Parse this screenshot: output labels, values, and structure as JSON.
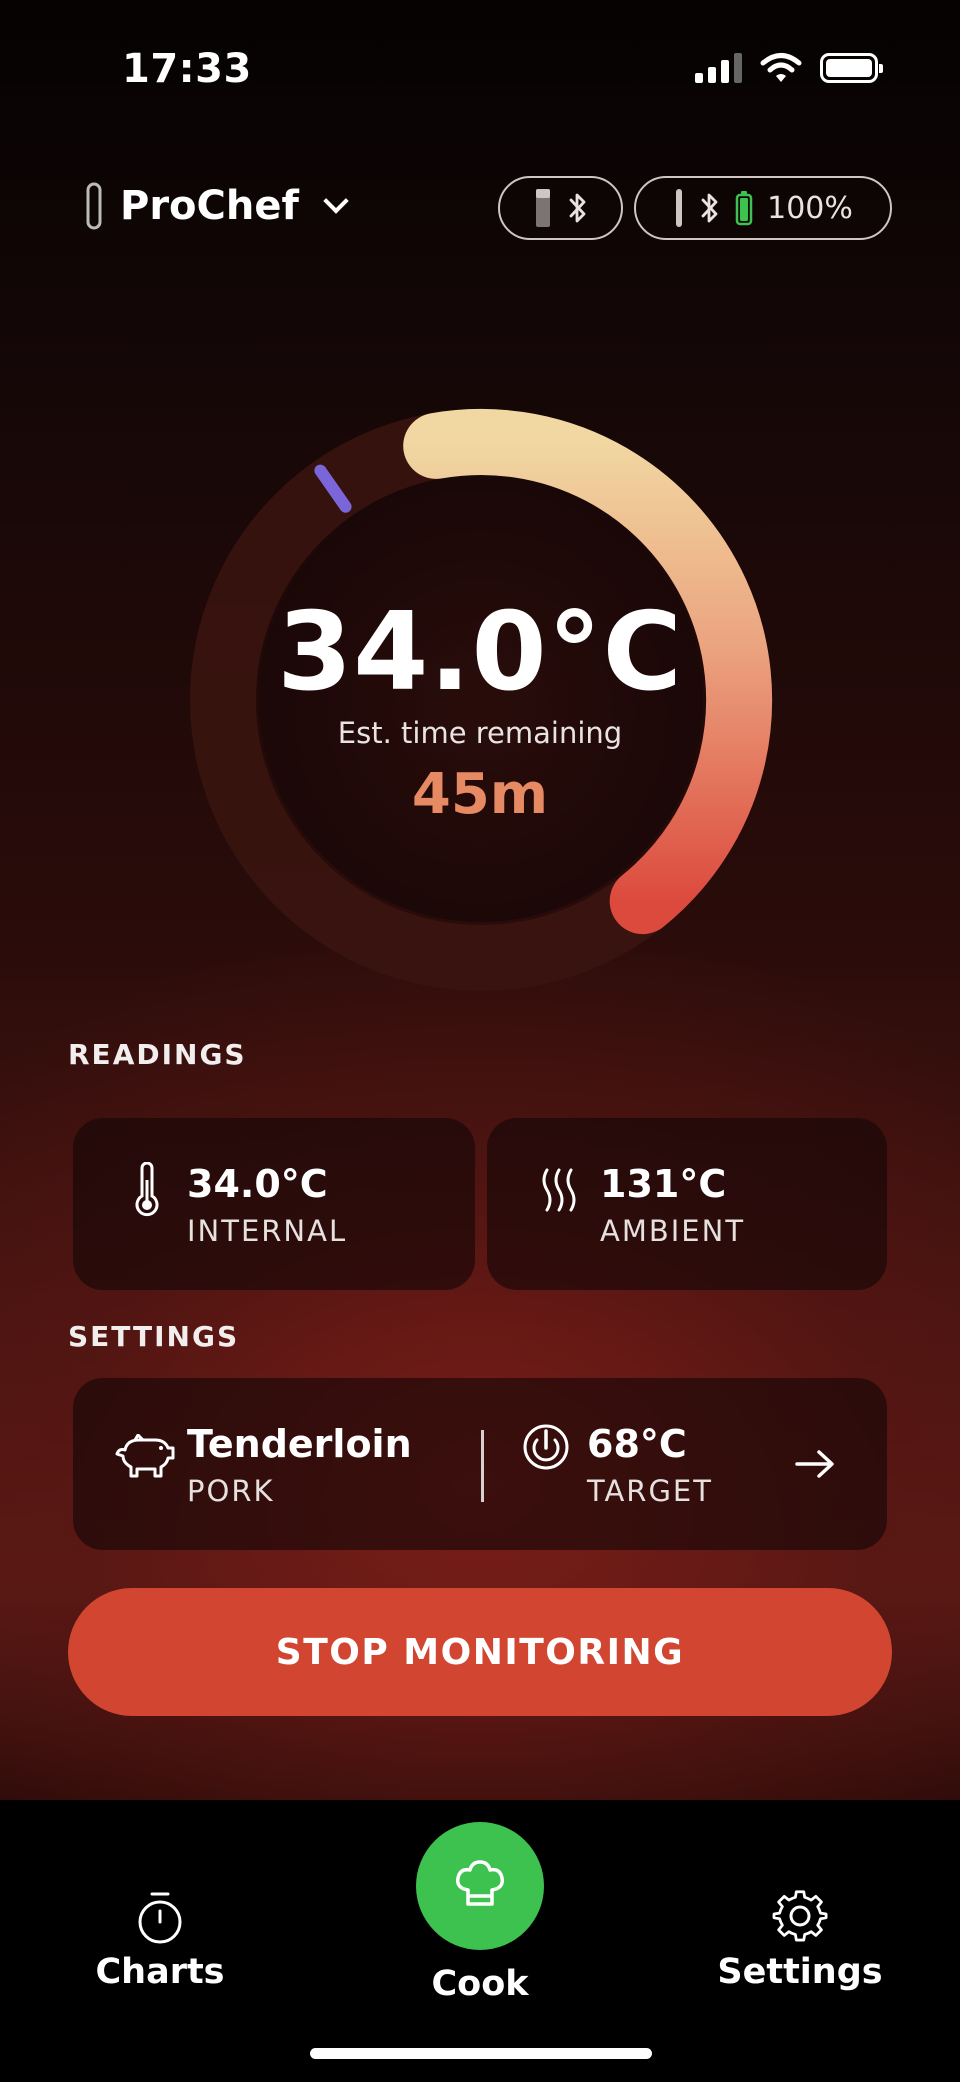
{
  "status_bar": {
    "time": "17:33",
    "icons": [
      "signal-icon",
      "wifi-icon",
      "battery-icon"
    ]
  },
  "header": {
    "device_name": "ProChef",
    "device_icon": "probe-icon",
    "pills": [
      {
        "icons": [
          "probe-icon",
          "bluetooth-icon"
        ]
      },
      {
        "icons": [
          "probe-icon",
          "bluetooth-icon",
          "battery-icon"
        ],
        "battery_text": "100%"
      }
    ]
  },
  "gauge": {
    "temperature": "34.0°C",
    "est_label": "Est. time remaining",
    "est_value": "45m",
    "progress_fraction": 0.42,
    "colors": {
      "start": "#f1d7a1",
      "end": "#dc4a3e",
      "track": "#3a140f",
      "marker": "#7a66d8"
    }
  },
  "readings": {
    "title": "READINGS",
    "internal": {
      "value": "34.0°C",
      "label": "INTERNAL",
      "icon": "thermometer-icon"
    },
    "ambient": {
      "value": "131°C",
      "label": "AMBIENT",
      "icon": "heat-waves-icon"
    }
  },
  "settings": {
    "title": "SETTINGS",
    "cut": {
      "name": "Tenderloin",
      "meat": "PORK",
      "icon": "pig-icon"
    },
    "target": {
      "value": "68°C",
      "label": "TARGET",
      "icon": "target-power-icon"
    },
    "arrow_icon": "arrow-right-icon"
  },
  "stop_button": {
    "label": "STOP MONITORING",
    "color": "#d24631"
  },
  "tabbar": {
    "charts": {
      "label": "Charts",
      "icon": "stopwatch-icon"
    },
    "cook": {
      "label": "Cook",
      "icon": "chef-hat-icon",
      "color": "#3ec24f"
    },
    "settings": {
      "label": "Settings",
      "icon": "gear-icon"
    }
  }
}
